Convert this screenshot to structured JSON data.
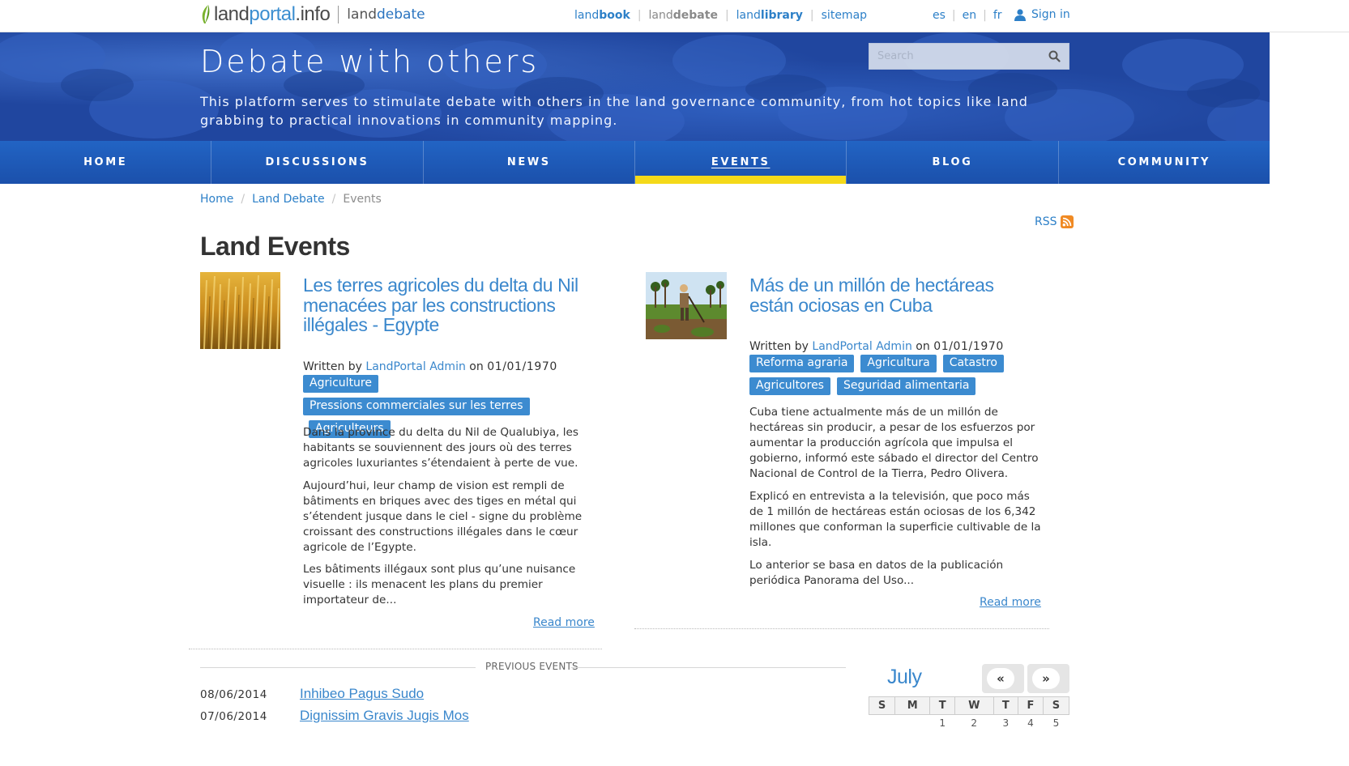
{
  "topbar": {
    "logo_main": "land",
    "logo_accent": "portal",
    "logo_suffix": ".info",
    "logo_sub_pre": "land",
    "logo_sub_acc": "debate",
    "site_nav": [
      {
        "pre": "land",
        "bold": "book",
        "muted": false
      },
      {
        "pre": "land",
        "bold": "debate",
        "muted": true
      },
      {
        "pre": "land",
        "bold": "library",
        "muted": false
      },
      {
        "pre": "sitemap",
        "bold": "",
        "muted": false
      }
    ],
    "languages": [
      "es",
      "en",
      "fr"
    ],
    "sign_in": "Sign in"
  },
  "hero": {
    "title": "Debate with others",
    "description": "This platform serves to stimulate debate with others in the land governance community, from hot topics like land grabbing to practical innovations in community mapping.",
    "search_placeholder": "Search"
  },
  "main_nav": [
    {
      "label": "HOME",
      "active": false
    },
    {
      "label": "DISCUSSIONS",
      "active": false
    },
    {
      "label": "NEWS",
      "active": false
    },
    {
      "label": "EVENTS",
      "active": true
    },
    {
      "label": "BLOG",
      "active": false
    },
    {
      "label": "COMMUNITY",
      "active": false
    }
  ],
  "breadcrumb": [
    "Home",
    "Land Debate",
    "Events"
  ],
  "rss": "RSS",
  "page_title": "Land Events",
  "events": [
    {
      "title": "Les terres agricoles du delta du Nil menacées par les constructions illégales - Egypte",
      "written_by": "Written by",
      "author": "LandPortal Admin",
      "on": "on",
      "date": "01/01/1970",
      "tags": [
        "Agriculture",
        "Pressions commerciales sur les terres",
        "Agriculteurs"
      ],
      "paragraphs": [
        "Dans la province du delta du Nil de Qualubiya, les habitants se souviennent des jours où des terres agricoles luxuriantes s’étendaient à perte de vue.",
        "Aujourd’hui, leur champ de vision est rempli de bâtiments en briques avec des tiges en métal qui s’étendent jusque dans le ciel - signe du problème croissant des constructions illégales dans le cœur agricole de l’Egypte.",
        "Les bâtiments illégaux sont plus qu’une nuisance visuelle : ils menacent les plans du premier importateur de..."
      ],
      "read_more": "Read more"
    },
    {
      "title": "Más de un millón de hectáreas están ociosas en Cuba",
      "written_by": "Written by",
      "author": "LandPortal Admin",
      "on": "on",
      "date": "01/01/1970",
      "tags": [
        "Reforma agraria",
        "Agricultura",
        "Catastro",
        "Agricultores",
        "Seguridad alimentaria"
      ],
      "paragraphs": [
        "Cuba tiene actualmente más de un millón de hectáreas sin producir, a pesar de los esfuerzos por aumentar la producción agrícola que impulsa el gobierno, informó este sábado el director del Centro Nacional de Control de la Tierra, Pedro Olivera.",
        "Explicó en entrevista a la televisión, que poco más de 1 millón de hectáreas están ociosas de los 6,342 millones que conforman la superficie cultivable de la isla.",
        "Lo anterior se basa en datos de la publicación periódica Panorama del Uso..."
      ],
      "read_more": "Read more"
    }
  ],
  "previous_events": {
    "heading": "PREVIOUS EVENTS",
    "items": [
      {
        "date": "08/06/2014",
        "title": "Inhibeo Pagus Sudo"
      },
      {
        "date": "07/06/2014",
        "title": "Dignissim Gravis Jugis Mos"
      }
    ]
  },
  "calendar": {
    "month": "July",
    "prev": "«",
    "next": "»",
    "weekdays": [
      "S",
      "M",
      "T",
      "W",
      "T",
      "F",
      "S"
    ],
    "first_row": [
      "",
      "",
      "1",
      "2",
      "3",
      "4",
      "5"
    ]
  },
  "colors": {
    "accent": "#3a87cc",
    "nav_bg": "#1e56b5",
    "active_bar": "#f4d91a",
    "tag_bg": "#3c8bd0"
  }
}
